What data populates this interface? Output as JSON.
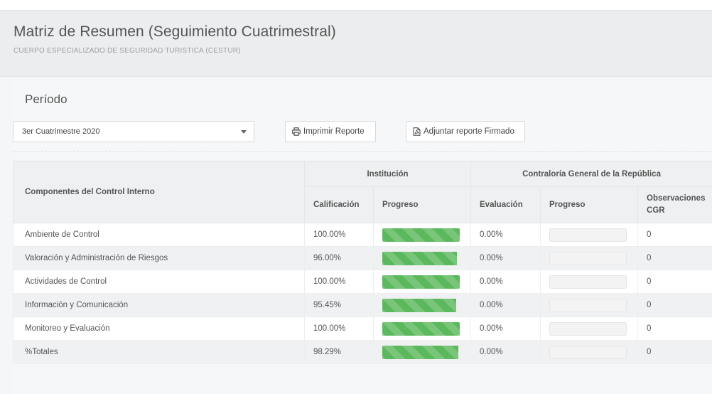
{
  "header": {
    "title": "Matriz de Resumen (Seguimiento Cuatrimestral)",
    "subtitle": "CUERPO ESPECIALIZADO DE SEGURIDAD TURISTICA (CESTUR)"
  },
  "period": {
    "label": "Período",
    "selected": "3er Cuatrimestre 2020"
  },
  "toolbar": {
    "print_label": "Imprimir Reporte",
    "attach_label": "Adjuntar reporte Firmado",
    "print_icon": "printer-icon",
    "attach_icon": "pdf-file-icon"
  },
  "table": {
    "col_components": "Componentes del Control Interno",
    "group_institution": "Institución",
    "group_cgr": "Contraloría General de la República",
    "col_calificacion": "Calificación",
    "col_progreso_inst": "Progreso",
    "col_evaluacion": "Evaluación",
    "col_progreso_cgr": "Progreso",
    "col_observaciones": "Observaciones CGR",
    "rows": [
      {
        "name": "Ambiente de Control",
        "calificacion": "100.00%",
        "inst_progress": 1.0,
        "evaluacion": "0.00%",
        "cgr_progress": 0.0,
        "observaciones": "0"
      },
      {
        "name": "Valoración y Administración de Riesgos",
        "calificacion": "96.00%",
        "inst_progress": 0.96,
        "evaluacion": "0.00%",
        "cgr_progress": 0.0,
        "observaciones": "0"
      },
      {
        "name": "Actividades de Control",
        "calificacion": "100.00%",
        "inst_progress": 1.0,
        "evaluacion": "0.00%",
        "cgr_progress": 0.0,
        "observaciones": "0"
      },
      {
        "name": "Información y Comunicación",
        "calificacion": "95.45%",
        "inst_progress": 0.9545,
        "evaluacion": "0.00%",
        "cgr_progress": 0.0,
        "observaciones": "0"
      },
      {
        "name": "Monitoreo y Evaluación",
        "calificacion": "100.00%",
        "inst_progress": 1.0,
        "evaluacion": "0.00%",
        "cgr_progress": 0.0,
        "observaciones": "0"
      },
      {
        "name": "%Totales",
        "calificacion": "98.29%",
        "inst_progress": 0.9829,
        "evaluacion": "0.00%",
        "cgr_progress": 0.0,
        "observaciones": "0"
      }
    ]
  },
  "colors": {
    "progress_fill": "#5cb85c",
    "progress_track": "#f3f3f3"
  }
}
